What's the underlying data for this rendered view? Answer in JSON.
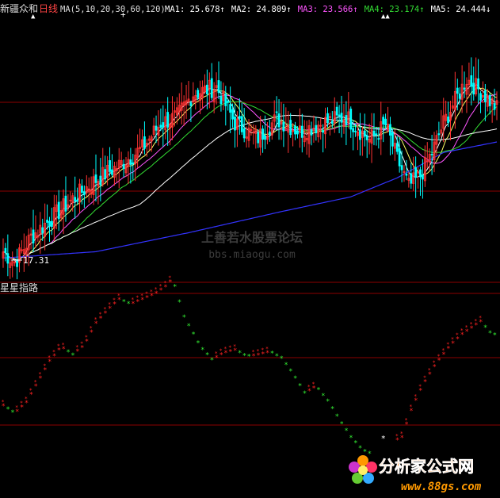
{
  "header": {
    "stock_name": "新疆众和",
    "period": "日线",
    "ma_params": "MA(5,10,20,30,60,120)",
    "ma_values": [
      {
        "label": "MA1:",
        "value": "25.678",
        "arrow": "↑",
        "color": "#ffffff"
      },
      {
        "label": "MA2:",
        "value": "24.809",
        "arrow": "↑",
        "color": "#ffffff"
      },
      {
        "label": "MA3:",
        "value": "23.566",
        "arrow": "↑",
        "color": "#ff55ff"
      },
      {
        "label": "MA4:",
        "value": "23.174",
        "arrow": "↑",
        "color": "#33dd33"
      },
      {
        "label": "MA5:",
        "value": "24.444",
        "arrow": "↓",
        "color": "#ffffff"
      }
    ]
  },
  "watermark": {
    "line1": "上善若水股票论坛",
    "line2": "bbs.miaogu.com"
  },
  "price_panel": {
    "low_label": "17.31"
  },
  "indicator_panel": {
    "title": "星星指路"
  },
  "logo": {
    "brand": "分析家公式网",
    "url": "www.88gs.com"
  },
  "colors": {
    "up_candle": "#ff3333",
    "down_candle": "#00ffff",
    "ma5": "#ffffff",
    "ma10": "#ffff66",
    "ma20": "#ff55ff",
    "ma30": "#33dd33",
    "ma60": "#ffffff",
    "ma120": "#3333ff",
    "grid": "#8b0000",
    "star_up": "#ff2222",
    "star_down": "#33ee33"
  },
  "chart_data": [
    {
      "type": "candlestick",
      "indicators": [
        "MA5",
        "MA10",
        "MA20",
        "MA30",
        "MA60",
        "MA120"
      ],
      "close_path": [
        [
          0,
          17.9
        ],
        [
          5,
          17.4
        ],
        [
          12,
          18.6
        ],
        [
          20,
          19.4
        ],
        [
          30,
          20.4
        ],
        [
          40,
          21.3
        ],
        [
          50,
          22.0
        ],
        [
          60,
          22.8
        ],
        [
          68,
          24.0
        ],
        [
          75,
          24.3
        ],
        [
          82,
          25.4
        ],
        [
          92,
          25.7
        ],
        [
          100,
          24.0
        ],
        [
          110,
          23.3
        ],
        [
          118,
          24.2
        ],
        [
          128,
          23.6
        ],
        [
          138,
          24.0
        ],
        [
          148,
          24.3
        ],
        [
          158,
          23.2
        ],
        [
          165,
          23.9
        ],
        [
          170,
          22.3
        ],
        [
          175,
          21.0
        ],
        [
          180,
          21.5
        ],
        [
          185,
          22.6
        ],
        [
          190,
          24.0
        ],
        [
          200,
          26.1
        ],
        [
          207,
          25.4
        ],
        [
          213,
          24.7
        ]
      ],
      "ma120_path": [
        [
          0,
          17.6
        ],
        [
          40,
          17.9
        ],
        [
          80,
          18.8
        ],
        [
          120,
          19.8
        ],
        [
          150,
          20.5
        ],
        [
          170,
          21.4
        ],
        [
          190,
          22.6
        ],
        [
          213,
          23.1
        ]
      ],
      "annotations": [
        "17.31"
      ]
    },
    {
      "type": "scatter",
      "name": "星星指路",
      "points_path": [
        [
          0,
          0.3
        ],
        [
          5,
          0.25
        ],
        [
          10,
          0.32
        ],
        [
          15,
          0.45
        ],
        [
          20,
          0.58
        ],
        [
          25,
          0.67
        ],
        [
          30,
          0.62
        ],
        [
          35,
          0.68
        ],
        [
          40,
          0.82
        ],
        [
          45,
          0.9
        ],
        [
          50,
          0.97
        ],
        [
          55,
          0.94
        ],
        [
          60,
          0.97
        ],
        [
          65,
          1.0
        ],
        [
          70,
          1.05
        ],
        [
          73,
          1.1
        ],
        [
          78,
          0.86
        ],
        [
          85,
          0.67
        ],
        [
          90,
          0.59
        ],
        [
          95,
          0.63
        ],
        [
          100,
          0.65
        ],
        [
          105,
          0.61
        ],
        [
          110,
          0.62
        ],
        [
          115,
          0.64
        ],
        [
          120,
          0.6
        ],
        [
          125,
          0.5
        ],
        [
          130,
          0.38
        ],
        [
          135,
          0.42
        ],
        [
          140,
          0.33
        ],
        [
          145,
          0.21
        ],
        [
          150,
          0.1
        ],
        [
          155,
          0.02
        ],
        [
          158,
          0.0
        ],
        [
          172,
          0.1
        ],
        [
          176,
          0.27
        ],
        [
          181,
          0.43
        ],
        [
          187,
          0.57
        ],
        [
          193,
          0.68
        ],
        [
          198,
          0.75
        ],
        [
          203,
          0.8
        ],
        [
          206,
          0.83
        ],
        [
          210,
          0.76
        ],
        [
          213,
          0.74
        ]
      ]
    }
  ]
}
